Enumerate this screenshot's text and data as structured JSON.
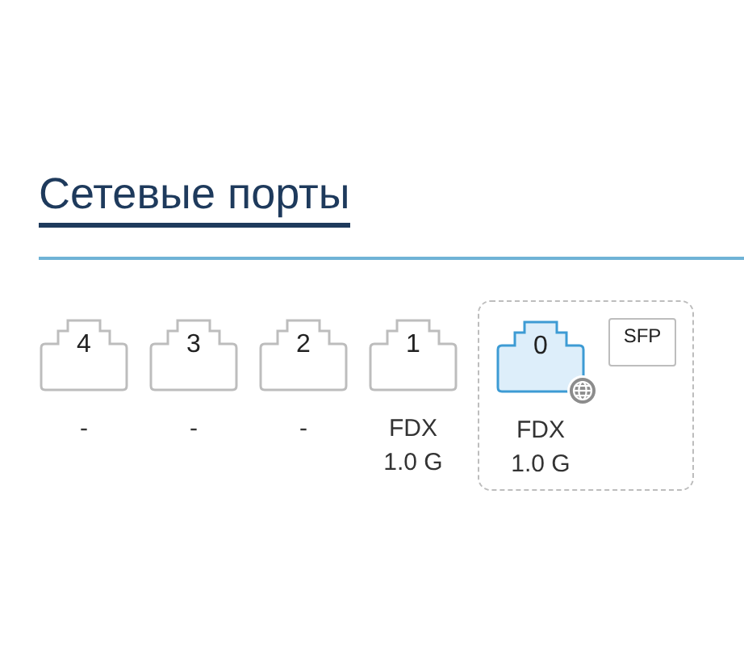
{
  "section": {
    "title": "Сетевые порты"
  },
  "ports": [
    {
      "label": "4",
      "active": false,
      "wan": false,
      "status": [
        "-"
      ]
    },
    {
      "label": "3",
      "active": false,
      "wan": false,
      "status": [
        "-"
      ]
    },
    {
      "label": "2",
      "active": false,
      "wan": false,
      "status": [
        "-"
      ]
    },
    {
      "label": "1",
      "active": false,
      "wan": false,
      "status": [
        "FDX",
        "1.0 G"
      ]
    }
  ],
  "combo": {
    "port": {
      "label": "0",
      "active": true,
      "wan": true,
      "status": [
        "FDX",
        "1.0 G"
      ]
    },
    "sfp": {
      "label": "SFP",
      "active": false
    }
  }
}
